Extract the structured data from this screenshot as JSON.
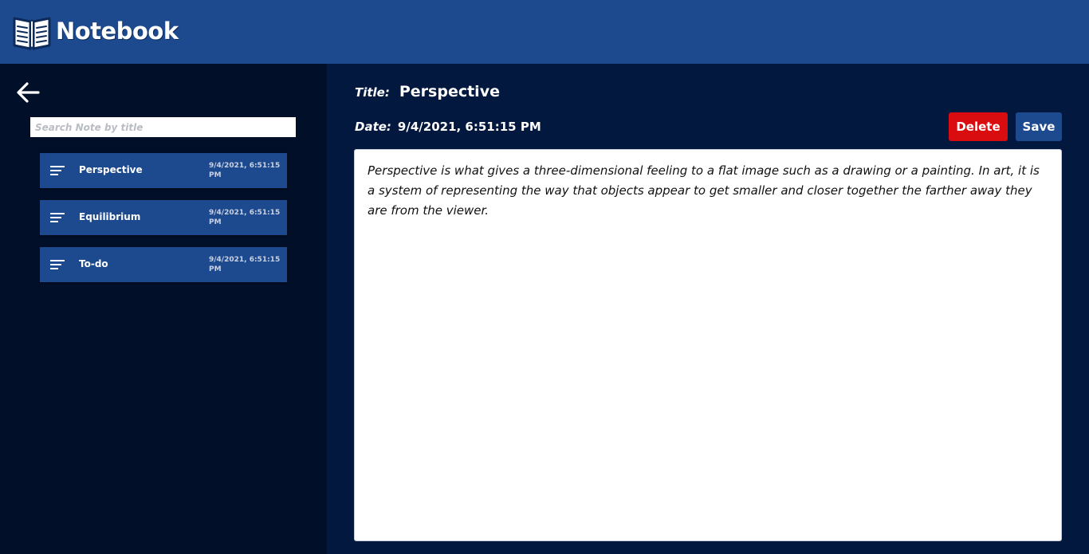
{
  "app": {
    "brand_name": "Notebook",
    "logo_icon": "open-book-icon"
  },
  "sidebar": {
    "back_icon": "arrow-left-icon",
    "search_placeholder": "Search Note by title",
    "search_value": "",
    "notes": [
      {
        "title": "Perspective",
        "date": "9/4/2021, 6:51:15 PM",
        "icon": "notes-lines-icon"
      },
      {
        "title": "Equilibrium",
        "date": "9/4/2021, 6:51:15 PM",
        "icon": "notes-lines-icon"
      },
      {
        "title": "To-do",
        "date": "9/4/2021, 6:51:15 PM",
        "icon": "notes-lines-icon"
      }
    ]
  },
  "editor": {
    "title_label": "Title:",
    "title_value": "Perspective",
    "date_label": "Date:",
    "date_value": "9/4/2021, 6:51:15 PM",
    "delete_label": "Delete",
    "save_label": "Save",
    "body": "Perspective is what gives a three-dimensional feeling to a flat image such as a drawing or a painting. In art, it is a system of representing the way that objects appear to get smaller and closer together the farther away they are from the viewer."
  },
  "colors": {
    "header": "#1d4a8f",
    "sidebar_bg": "#020f28",
    "main_bg": "#03183f",
    "delete": "#d90d10",
    "save": "#1d4a8f"
  }
}
